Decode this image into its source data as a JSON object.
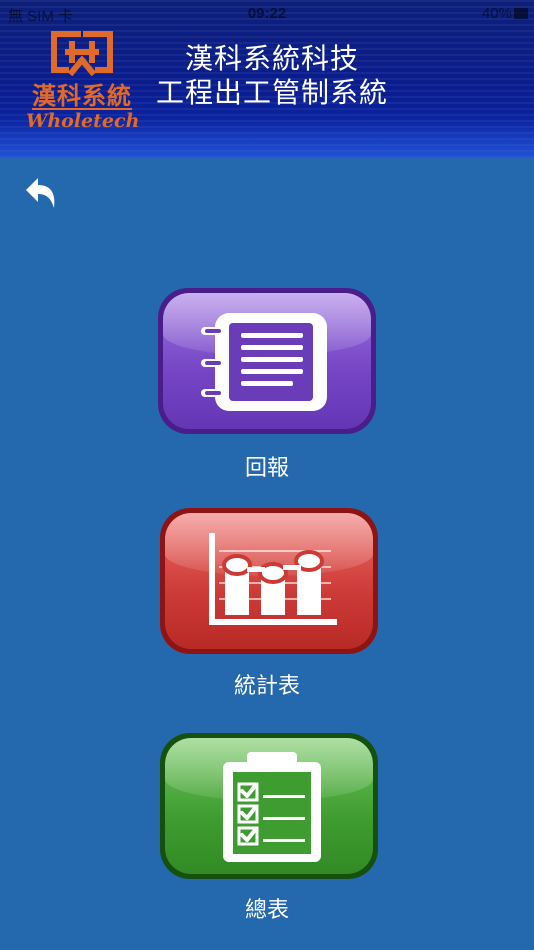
{
  "status_bar": {
    "carrier": "無 SIM 卡",
    "time": "09:22",
    "battery": "40%"
  },
  "header": {
    "logo_cn": "漢科系統",
    "logo_en": "Wholetech",
    "title_line1": "漢科系統科技",
    "title_line2": "工程出工管制系統"
  },
  "menu": {
    "report_label": "回報",
    "stats_label": "統計表",
    "summary_label": "總表"
  },
  "colors": {
    "background": "#2468ae",
    "header": "#0a1d8e",
    "report": "#7444c4",
    "stats": "#cc3a36",
    "summary": "#3f9c30",
    "logo": "#e06a2a"
  },
  "icons": {
    "back": "back-arrow-icon",
    "report": "notebook-icon",
    "stats": "bar-chart-icon",
    "summary": "checklist-clipboard-icon"
  }
}
